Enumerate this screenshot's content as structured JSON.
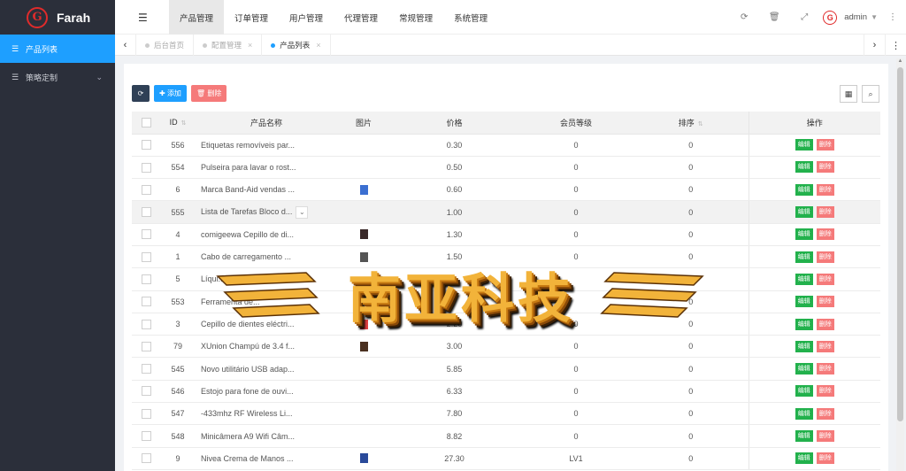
{
  "brand": {
    "name": "Farah",
    "logo_letter": "G"
  },
  "sidebar": {
    "items": [
      {
        "label": "产品列表",
        "icon": "list-icon",
        "active": true
      },
      {
        "label": "策略定制",
        "icon": "list-icon",
        "active": false
      }
    ]
  },
  "header": {
    "tabs": [
      "产品管理",
      "订单管理",
      "用户管理",
      "代理管理",
      "常规管理",
      "系统管理"
    ],
    "active_tab": 0,
    "user": "admin"
  },
  "page_tabs": [
    {
      "label": "后台首页",
      "closable": false,
      "active": false
    },
    {
      "label": "配置管理",
      "closable": true,
      "active": false
    },
    {
      "label": "产品列表",
      "closable": true,
      "active": true
    }
  ],
  "toolbar": {
    "add_label": "添加",
    "delete_label": "删除"
  },
  "table": {
    "headers": {
      "id": "ID",
      "name": "产品名称",
      "image": "图片",
      "price": "价格",
      "level": "会员等级",
      "sort": "排序",
      "ops": "操作"
    },
    "edit_label": "编辑",
    "delete_label": "删除",
    "rows": [
      {
        "id": "556",
        "name": "Etiquetas removíveis par...",
        "image": "",
        "price": "0.30",
        "level": "0",
        "sort": "0"
      },
      {
        "id": "554",
        "name": "Pulseira para lavar o rost...",
        "image": "",
        "price": "0.50",
        "level": "0",
        "sort": "0"
      },
      {
        "id": "6",
        "name": "Marca Band-Aid vendas ...",
        "image": "blue",
        "price": "0.60",
        "level": "0",
        "sort": "0"
      },
      {
        "id": "555",
        "name": "Lista de Tarefas Bloco d...",
        "image": "",
        "price": "1.00",
        "level": "0",
        "sort": "0"
      },
      {
        "id": "4",
        "name": "comigeewa Cepillo de di...",
        "image": "dark",
        "price": "1.30",
        "level": "0",
        "sort": "0"
      },
      {
        "id": "1",
        "name": "Cabo de carregamento ...",
        "image": "cable",
        "price": "1.50",
        "level": "0",
        "sort": "0"
      },
      {
        "id": "5",
        "name": "Líqui...",
        "image": "",
        "price": "",
        "level": "",
        "sort": "0"
      },
      {
        "id": "553",
        "name": "Ferramenta de...",
        "image": "",
        "price": "",
        "level": "",
        "sort": "0"
      },
      {
        "id": "3",
        "name": "Cepillo de dientes eléctri...",
        "image": "red",
        "price": "2.20",
        "level": "0",
        "sort": "0"
      },
      {
        "id": "79",
        "name": "XUnion Champú de 3.4 f...",
        "image": "bottle",
        "price": "3.00",
        "level": "0",
        "sort": "0"
      },
      {
        "id": "545",
        "name": "Novo utilitário USB adap...",
        "image": "",
        "price": "5.85",
        "level": "0",
        "sort": "0"
      },
      {
        "id": "546",
        "name": "Estojo para fone de ouvi...",
        "image": "",
        "price": "6.33",
        "level": "0",
        "sort": "0"
      },
      {
        "id": "547",
        "name": "-433mhz RF Wireless Li...",
        "image": "",
        "price": "7.80",
        "level": "0",
        "sort": "0"
      },
      {
        "id": "548",
        "name": "Minicâmera A9 Wifi Câm...",
        "image": "",
        "price": "8.82",
        "level": "0",
        "sort": "0"
      },
      {
        "id": "9",
        "name": "Nivea Crema de Manos ...",
        "image": "tube",
        "price": "27.30",
        "level": "LV1",
        "sort": "0"
      }
    ]
  },
  "watermark": {
    "text": "南亚科技"
  },
  "colors": {
    "sidebar_bg": "#2b2f3a",
    "accent": "#1e9fff",
    "edit": "#22b14c",
    "delete": "#f57a7a"
  }
}
